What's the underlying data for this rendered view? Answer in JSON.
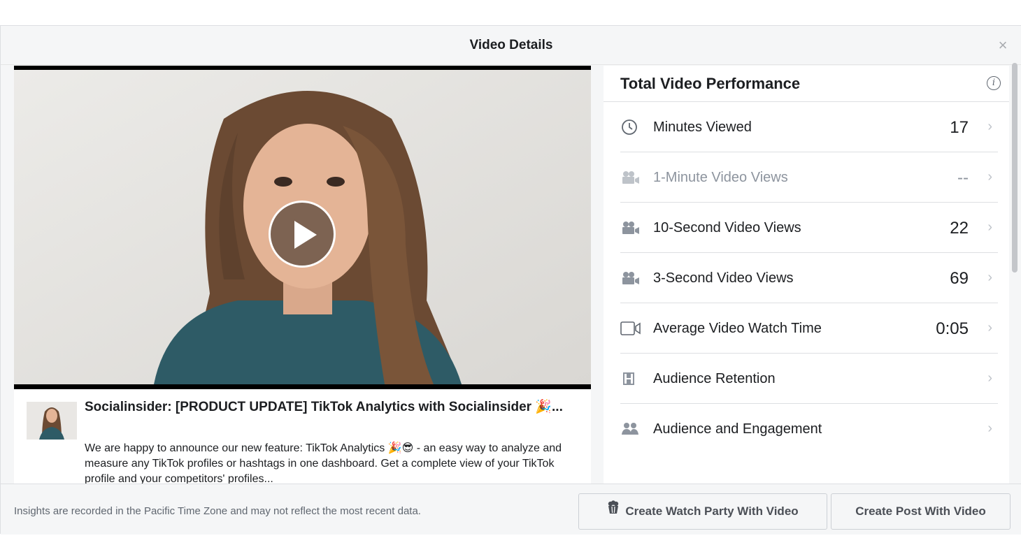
{
  "modal": {
    "title": "Video Details",
    "close_label": "×"
  },
  "post": {
    "title": "Socialinsider: [PRODUCT UPDATE] TikTok Analytics with Socialinsider 🎉...",
    "description": "We are happy to announce our new feature: TikTok Analytics 🎉😎 - an easy way to analyze and measure any TikTok profiles or hashtags in one dashboard. Get a complete view of your TikTok profile and your competitors' profiles..."
  },
  "performance": {
    "title": "Total Video Performance",
    "info_label": "i",
    "metrics": [
      {
        "label": "Minutes Viewed",
        "value": "17",
        "icon": "clock-icon"
      },
      {
        "label": "1-Minute Video Views",
        "value": "--",
        "icon": "video-camera-icon"
      },
      {
        "label": "10-Second Video Views",
        "value": "22",
        "icon": "video-camera-icon"
      },
      {
        "label": "3-Second Video Views",
        "value": "69",
        "icon": "video-camera-icon"
      },
      {
        "label": "Average Video Watch Time",
        "value": "0:05",
        "icon": "video-outline-icon"
      },
      {
        "label": "Audience Retention",
        "value": "",
        "icon": "film-strip-icon"
      },
      {
        "label": "Audience and Engagement",
        "value": "",
        "icon": "people-icon"
      }
    ],
    "chevron": "›"
  },
  "footer": {
    "note": "Insights are recorded in the Pacific Time Zone and may not reflect the most recent data.",
    "watch_party_label": "Create Watch Party With Video",
    "create_post_label": "Create Post With Video"
  },
  "colors": {
    "text_primary": "#1c1e21",
    "text_muted": "#8d949e",
    "icon_gray": "#606770",
    "border": "#dddfe2",
    "background": "#f5f6f7"
  }
}
